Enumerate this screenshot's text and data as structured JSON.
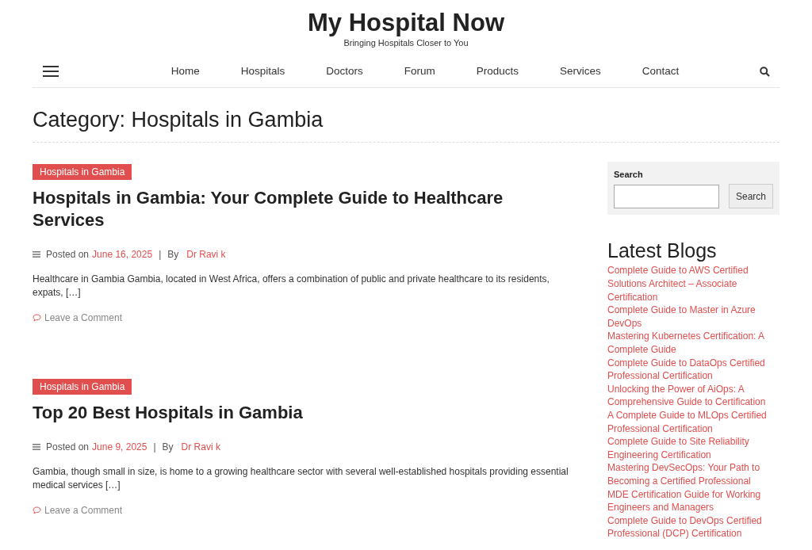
{
  "site": {
    "title": "My Hospital Now",
    "tagline": "Bringing Hospitals Closer to You"
  },
  "nav": {
    "items": [
      {
        "label": "Home"
      },
      {
        "label": "Hospitals"
      },
      {
        "label": "Doctors"
      },
      {
        "label": "Forum"
      },
      {
        "label": "Products"
      },
      {
        "label": "Services"
      },
      {
        "label": "Contact"
      }
    ]
  },
  "page_title": "Category: Hospitals in Gambia",
  "posts": [
    {
      "category": "Hospitals in Gambia",
      "title": "Hospitals in Gambia: Your Complete Guide to Healthcare Services",
      "posted_label": "Posted on",
      "date": "June 16, 2025",
      "separator": "|",
      "by_label": "By",
      "author": "Dr Ravi k",
      "excerpt": "Healthcare in Gambia Gambia, located in West Africa, offers a combination of public and private healthcare to its residents, expats, […]",
      "comment_link": "Leave a Comment"
    },
    {
      "category": "Hospitals in Gambia",
      "title": "Top 20 Best Hospitals in Gambia",
      "posted_label": "Posted on",
      "date": "June 9, 2025",
      "separator": "|",
      "by_label": "By",
      "author": "Dr Ravi k",
      "excerpt": "Gambia, though small in size, is home to a growing healthcare sector with several well-established hospitals providing essential medical services […]",
      "comment_link": "Leave a Comment"
    }
  ],
  "sidebar": {
    "search": {
      "label": "Search",
      "button": "Search"
    },
    "latest_blogs": {
      "heading": "Latest Blogs",
      "items": [
        "Complete Guide to AWS Certified Solutions Architect – Associate Certification",
        "Complete Guide to Master in Azure DevOps",
        "Mastering Kubernetes Certification: A Complete Guide",
        "Complete Guide to DataOps Certified Professional Certification",
        "Unlocking the Power of AiOps: A Comprehensive Guide to Certification",
        "A Complete Guide to MLOps Certified Professional Certification",
        "Complete Guide to Site Reliability Engineering Certification",
        "Mastering DevSecOps: Your Path to Becoming a Certified Professional",
        "MDE Certification Guide for Working Engineers and Managers",
        "Complete Guide to DevOps Certified Professional (DCP) Certification"
      ]
    }
  }
}
